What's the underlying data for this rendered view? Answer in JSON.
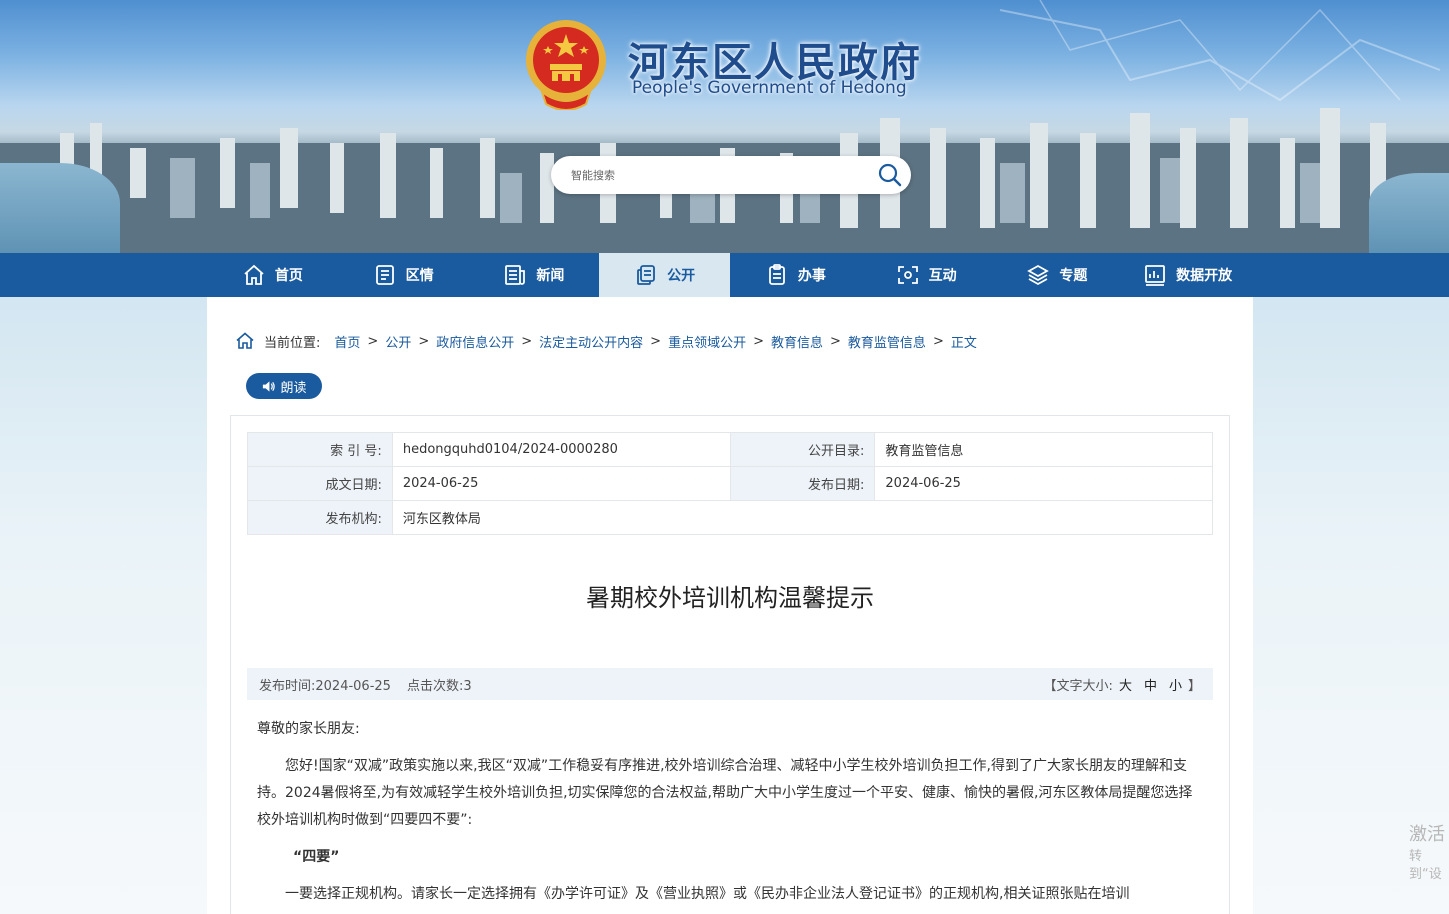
{
  "header": {
    "title": "河东区人民政府",
    "subtitle": "People's Government of Hedong",
    "search_placeholder": "智能搜索"
  },
  "nav": [
    {
      "label": "首页",
      "icon": "home-icon"
    },
    {
      "label": "区情",
      "icon": "document-icon"
    },
    {
      "label": "新闻",
      "icon": "news-icon"
    },
    {
      "label": "公开",
      "icon": "public-doc-icon",
      "active": true
    },
    {
      "label": "办事",
      "icon": "clipboard-icon"
    },
    {
      "label": "互动",
      "icon": "interaction-icon"
    },
    {
      "label": "专题",
      "icon": "layers-icon"
    },
    {
      "label": "数据开放",
      "icon": "data-chart-icon"
    }
  ],
  "breadcrumb": {
    "prefix": "当前位置:",
    "items": [
      "首页",
      "公开",
      "政府信息公开",
      "法定主动公开内容",
      "重点领域公开",
      "教育信息",
      "教育监管信息",
      "正文"
    ]
  },
  "read_button": "朗读",
  "meta": {
    "index_label": "索 引 号:",
    "index_value": "hedongquhd0104/2024-0000280",
    "catalog_label": "公开目录:",
    "catalog_value": "教育监管信息",
    "created_label": "成文日期:",
    "created_value": "2024-06-25",
    "published_label": "发布日期:",
    "published_value": "2024-06-25",
    "org_label": "发布机构:",
    "org_value": "河东区教体局"
  },
  "article": {
    "title": "暑期校外培训机构温馨提示",
    "publish_time": "发布时间:2024-06-25",
    "clicks": "点击次数:3",
    "font_size_open": "【文字大小:",
    "font_large": "大",
    "font_medium": "中",
    "font_small": "小",
    "font_size_close": "】",
    "greeting": "尊敬的家长朋友:",
    "para1": "您好!国家“双减”政策实施以来,我区“双减”工作稳妥有序推进,校外培训综合治理、减轻中小学生校外培训负担工作,得到了广大家长朋友的理解和支持。2024暑假将至,为有效减轻学生校外培训负担,切实保障您的合法权益,帮助广大中小学生度过一个平安、健康、愉快的暑假,河东区教体局提醒您选择校外培训机构时做到“四要四不要”:",
    "subheading": "“四要”",
    "para2": "一要选择正规机构。请家长一定选择拥有《办学许可证》及《营业执照》或《民办非企业法人登记证书》的正规机构,相关证照张贴在培训"
  },
  "watermark": {
    "line1": "激活",
    "line2": "转到“设"
  },
  "colors": {
    "nav_bg": "#1a5a9e",
    "nav_active_bg": "#d9e7f1",
    "title_blue": "#1f4c8c",
    "meta_key_bg": "#eef3f9"
  }
}
